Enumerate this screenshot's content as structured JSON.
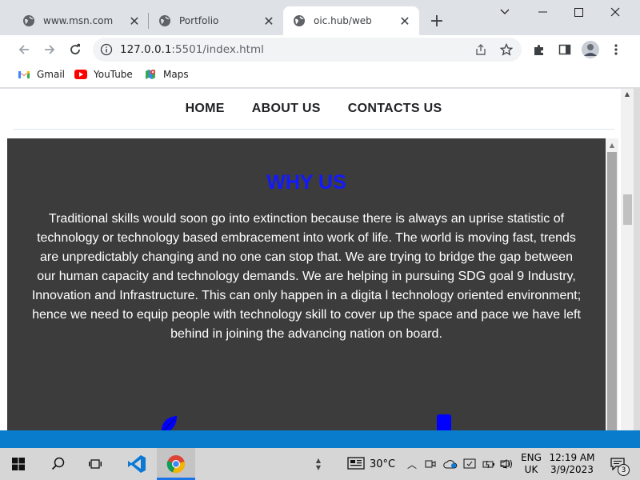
{
  "browser": {
    "tabs": [
      {
        "label": "www.msn.com",
        "icon": "globe-icon",
        "active": false
      },
      {
        "label": "Portfolio",
        "icon": "globe-icon",
        "active": false
      },
      {
        "label": "oic.hub/web",
        "icon": "globe-icon",
        "active": true
      }
    ],
    "url": {
      "host": "127.0.0.1",
      "rest": ":5501/index.html"
    },
    "bookmarks": [
      {
        "label": "Gmail",
        "icon": "gmail-icon"
      },
      {
        "label": "YouTube",
        "icon": "youtube-icon"
      },
      {
        "label": "Maps",
        "icon": "maps-icon"
      }
    ]
  },
  "page": {
    "nav": [
      "HOME",
      "ABOUT US",
      "CONTACTS US"
    ],
    "why_title": "WHY US",
    "why_text": "Traditional skills would soon go into extinction because there is always an uprise statistic of technology or technology based embracement into work of life. The world is moving fast, trends are unpredictably changing and no one can stop that. We are trying to bridge the gap between our human capacity and technology demands. We are helping in pursuing SDG goal 9 Industry, Innovation and Infrastructure. This can only happen in a digita l technology oriented environment; hence we need to equip people with technology skill to cover up the space and pace we have left behind in joining the advancing nation on board.",
    "colors": {
      "title": "#1219ff",
      "content_bg": "#3c3c3c",
      "icon": "#0000ff"
    }
  },
  "taskbar": {
    "weather": "30°C",
    "lang_top": "ENG",
    "lang_bottom": "UK",
    "time": "12:19 AM",
    "date": "3/9/2023",
    "notifications": "3"
  }
}
